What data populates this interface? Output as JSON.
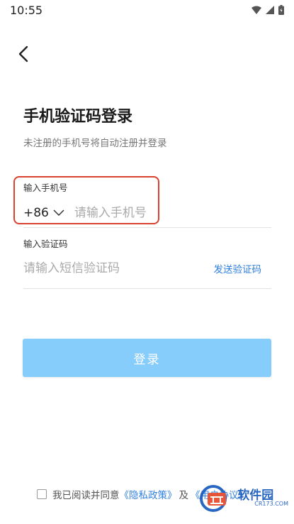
{
  "status_bar": {
    "time": "10:55"
  },
  "header": {
    "back_icon": "chevron-left-icon"
  },
  "page": {
    "title": "手机验证码登录",
    "subtitle": "未注册的手机号将自动注册并登录"
  },
  "phone_field": {
    "label": "输入手机号",
    "country_code": "+86",
    "placeholder": "请输入手机号",
    "value": ""
  },
  "code_field": {
    "label": "输入验证码",
    "placeholder": "请输入短信验证码",
    "value": "",
    "send_label": "发送验证码"
  },
  "login_button": {
    "label": "登录",
    "color": "#87cdfc"
  },
  "agreement": {
    "prefix": "我已阅读并同意",
    "privacy_link": "《隐私政策》",
    "and": "及",
    "terms_link": "《用户协议》",
    "checked": false
  },
  "watermark": {
    "text": "软件园",
    "sub": "CR173.COM"
  },
  "colors": {
    "accent": "#2f7fe0",
    "highlight": "#d8422f",
    "button": "#87cdfc"
  }
}
